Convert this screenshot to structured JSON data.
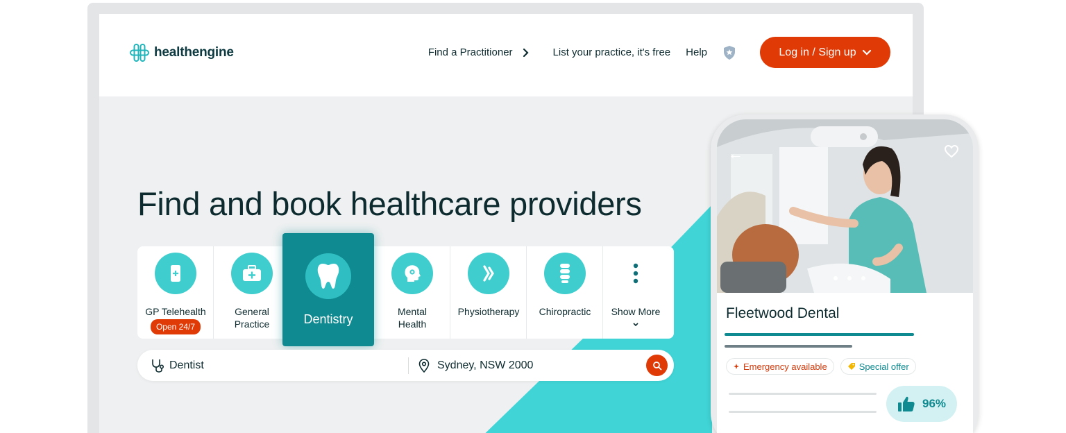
{
  "brand": {
    "name": "healthengine",
    "accent": "#3fcdcd",
    "primary": "#e03a06",
    "teal_dark": "#0e8a90"
  },
  "nav": {
    "find_practitioner": "Find a Practitioner",
    "list_practice": "List your practice, it's free",
    "help": "Help",
    "login": "Log in / Sign up"
  },
  "hero": {
    "title": "Find and book healthcare providers"
  },
  "categories": [
    {
      "label": "GP Telehealth",
      "badge": "Open 24/7",
      "icon": "phone-plus-icon"
    },
    {
      "label": "General Practice",
      "icon": "medical-kit-icon"
    },
    {
      "label": "Dentistry",
      "icon": "tooth-icon",
      "selected": true
    },
    {
      "label": "Mental Health",
      "icon": "head-gear-icon"
    },
    {
      "label": "Physiotherapy",
      "icon": "joint-icon"
    },
    {
      "label": "Chiropractic",
      "icon": "spine-icon"
    },
    {
      "label": "Show More",
      "icon": "more-vertical-icon"
    }
  ],
  "search": {
    "query": "Dentist",
    "location": "Sydney, NSW 2000"
  },
  "phone": {
    "practice_name": "Fleetwood Dental",
    "tags": {
      "emergency": "Emergency available",
      "offer": "Special offer"
    },
    "rating": "96%",
    "carousel_total": 3,
    "carousel_active": 1
  }
}
